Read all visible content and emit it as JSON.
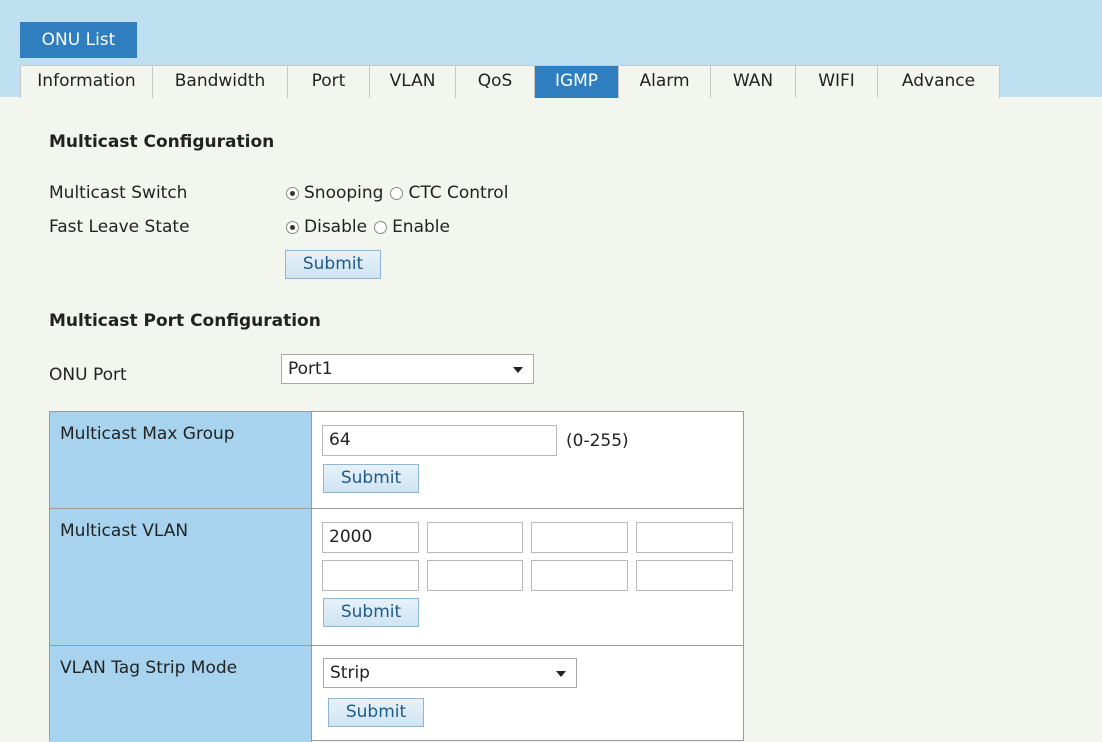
{
  "header": {
    "onu_list_label": "ONU List",
    "tabs": [
      {
        "label": "Information",
        "active": false
      },
      {
        "label": "Bandwidth",
        "active": false
      },
      {
        "label": "Port",
        "active": false
      },
      {
        "label": "VLAN",
        "active": false
      },
      {
        "label": "QoS",
        "active": false
      },
      {
        "label": "IGMP",
        "active": true
      },
      {
        "label": "Alarm",
        "active": false
      },
      {
        "label": "WAN",
        "active": false
      },
      {
        "label": "WIFI",
        "active": false
      },
      {
        "label": "Advance",
        "active": false
      }
    ]
  },
  "multicast_config": {
    "title": "Multicast Configuration",
    "switch_label": "Multicast Switch",
    "switch_options": [
      "Snooping",
      "CTC Control"
    ],
    "switch_selected": "Snooping",
    "fast_leave_label": "Fast Leave State",
    "fast_leave_options": [
      "Disable",
      "Enable"
    ],
    "fast_leave_selected": "Disable",
    "submit_label": "Submit"
  },
  "port_config": {
    "title": "Multicast Port Configuration",
    "onu_port_label": "ONU Port",
    "onu_port_value": "Port1",
    "max_group": {
      "label": "Multicast Max Group",
      "value": "64",
      "range": "(0-255)",
      "submit_label": "Submit"
    },
    "vlan": {
      "label": "Multicast VLAN",
      "values": [
        "2000",
        "",
        "",
        "",
        "",
        "",
        "",
        ""
      ],
      "submit_label": "Submit"
    },
    "tag_strip": {
      "label": "VLAN Tag Strip Mode",
      "value": "Strip",
      "submit_label": "Submit"
    }
  },
  "colors": {
    "top_bar": "#bfe0f1",
    "active_tab": "#2f7fc0",
    "table_header": "#a7d3ef",
    "page_background": "#f3f6ee"
  }
}
